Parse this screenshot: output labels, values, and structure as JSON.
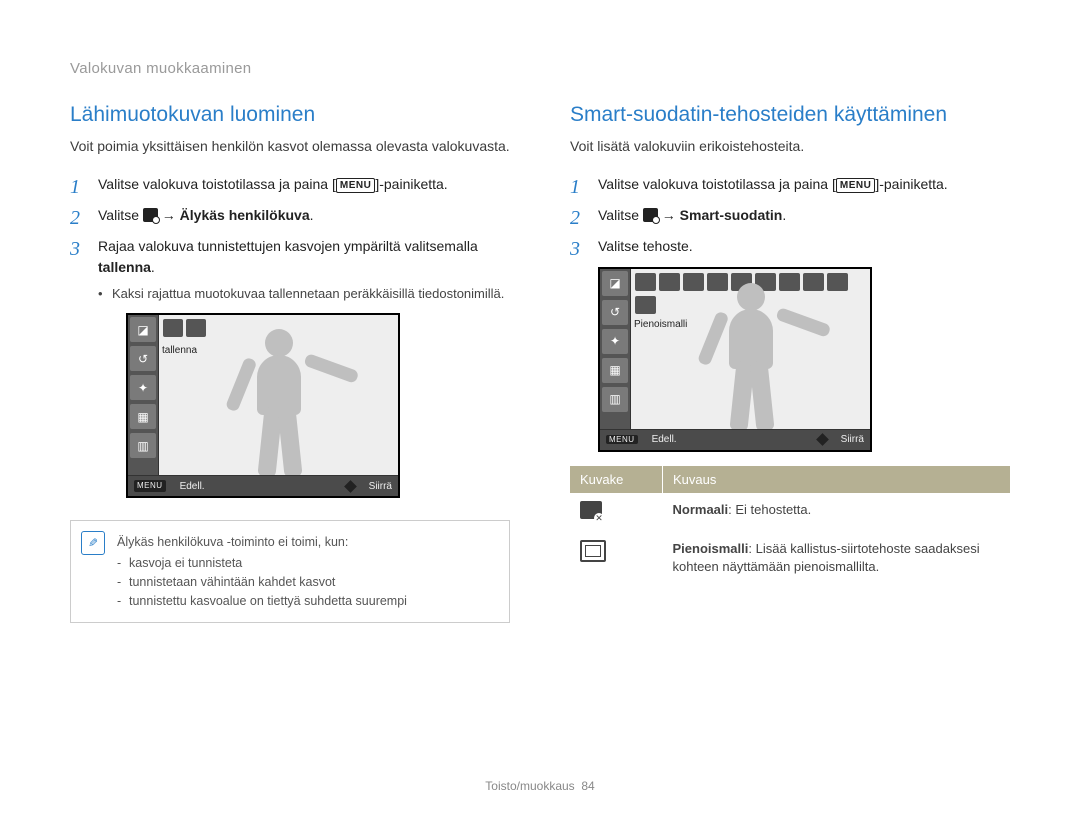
{
  "breadcrumb": "Valokuvan muokkaaminen",
  "left": {
    "heading": "Lähimuotokuvan luominen",
    "intro": "Voit poimia yksittäisen henkilön kasvot olemassa olevasta valokuvasta.",
    "step1_a": "Valitse valokuva toistotilassa ja paina [",
    "menu": "MENU",
    "step1_b": "]-painiketta.",
    "step2_a": "Valitse ",
    "arrow": " → ",
    "step2_b": "Älykäs henkilökuva",
    "step3_a": "Rajaa valokuva tunnistettujen kasvojen ympäriltä valitsemalla ",
    "step3_b": "tallenna",
    "sub1": "Kaksi rajattua muotokuvaa tallennetaan peräkkäisillä tiedostonimillä.",
    "lcd_label": "tallenna",
    "foot_prev": "Edell.",
    "foot_move": "Siirrä"
  },
  "note": {
    "title": "Älykäs henkilökuva -toiminto ei toimi, kun:",
    "items": [
      "kasvoja ei tunnisteta",
      "tunnistetaan vähintään kahdet kasvot",
      "tunnistettu kasvoalue on tiettyä suhdetta suurempi"
    ]
  },
  "right": {
    "heading": "Smart-suodatin-tehosteiden käyttäminen",
    "intro": "Voit lisätä valokuviin erikoistehosteita.",
    "step1_a": "Valitse valokuva toistotilassa ja paina [",
    "step1_b": "]-painiketta.",
    "step2_a": "Valitse ",
    "step2_b": "Smart-suodatin",
    "step3": "Valitse tehoste.",
    "lcd_label": "Pienoismalli",
    "foot_prev": "Edell.",
    "foot_move": "Siirrä"
  },
  "table": {
    "h1": "Kuvake",
    "h2": "Kuvaus",
    "r1_b": "Normaali",
    "r1": ": Ei tehostetta.",
    "r2_b": "Pienoismalli",
    "r2": ": Lisää kallistus-siirtotehoste saadaksesi kohteen näyttämään pienoismallilta."
  },
  "footer_section": "Toisto/muokkaus",
  "footer_page": "84"
}
